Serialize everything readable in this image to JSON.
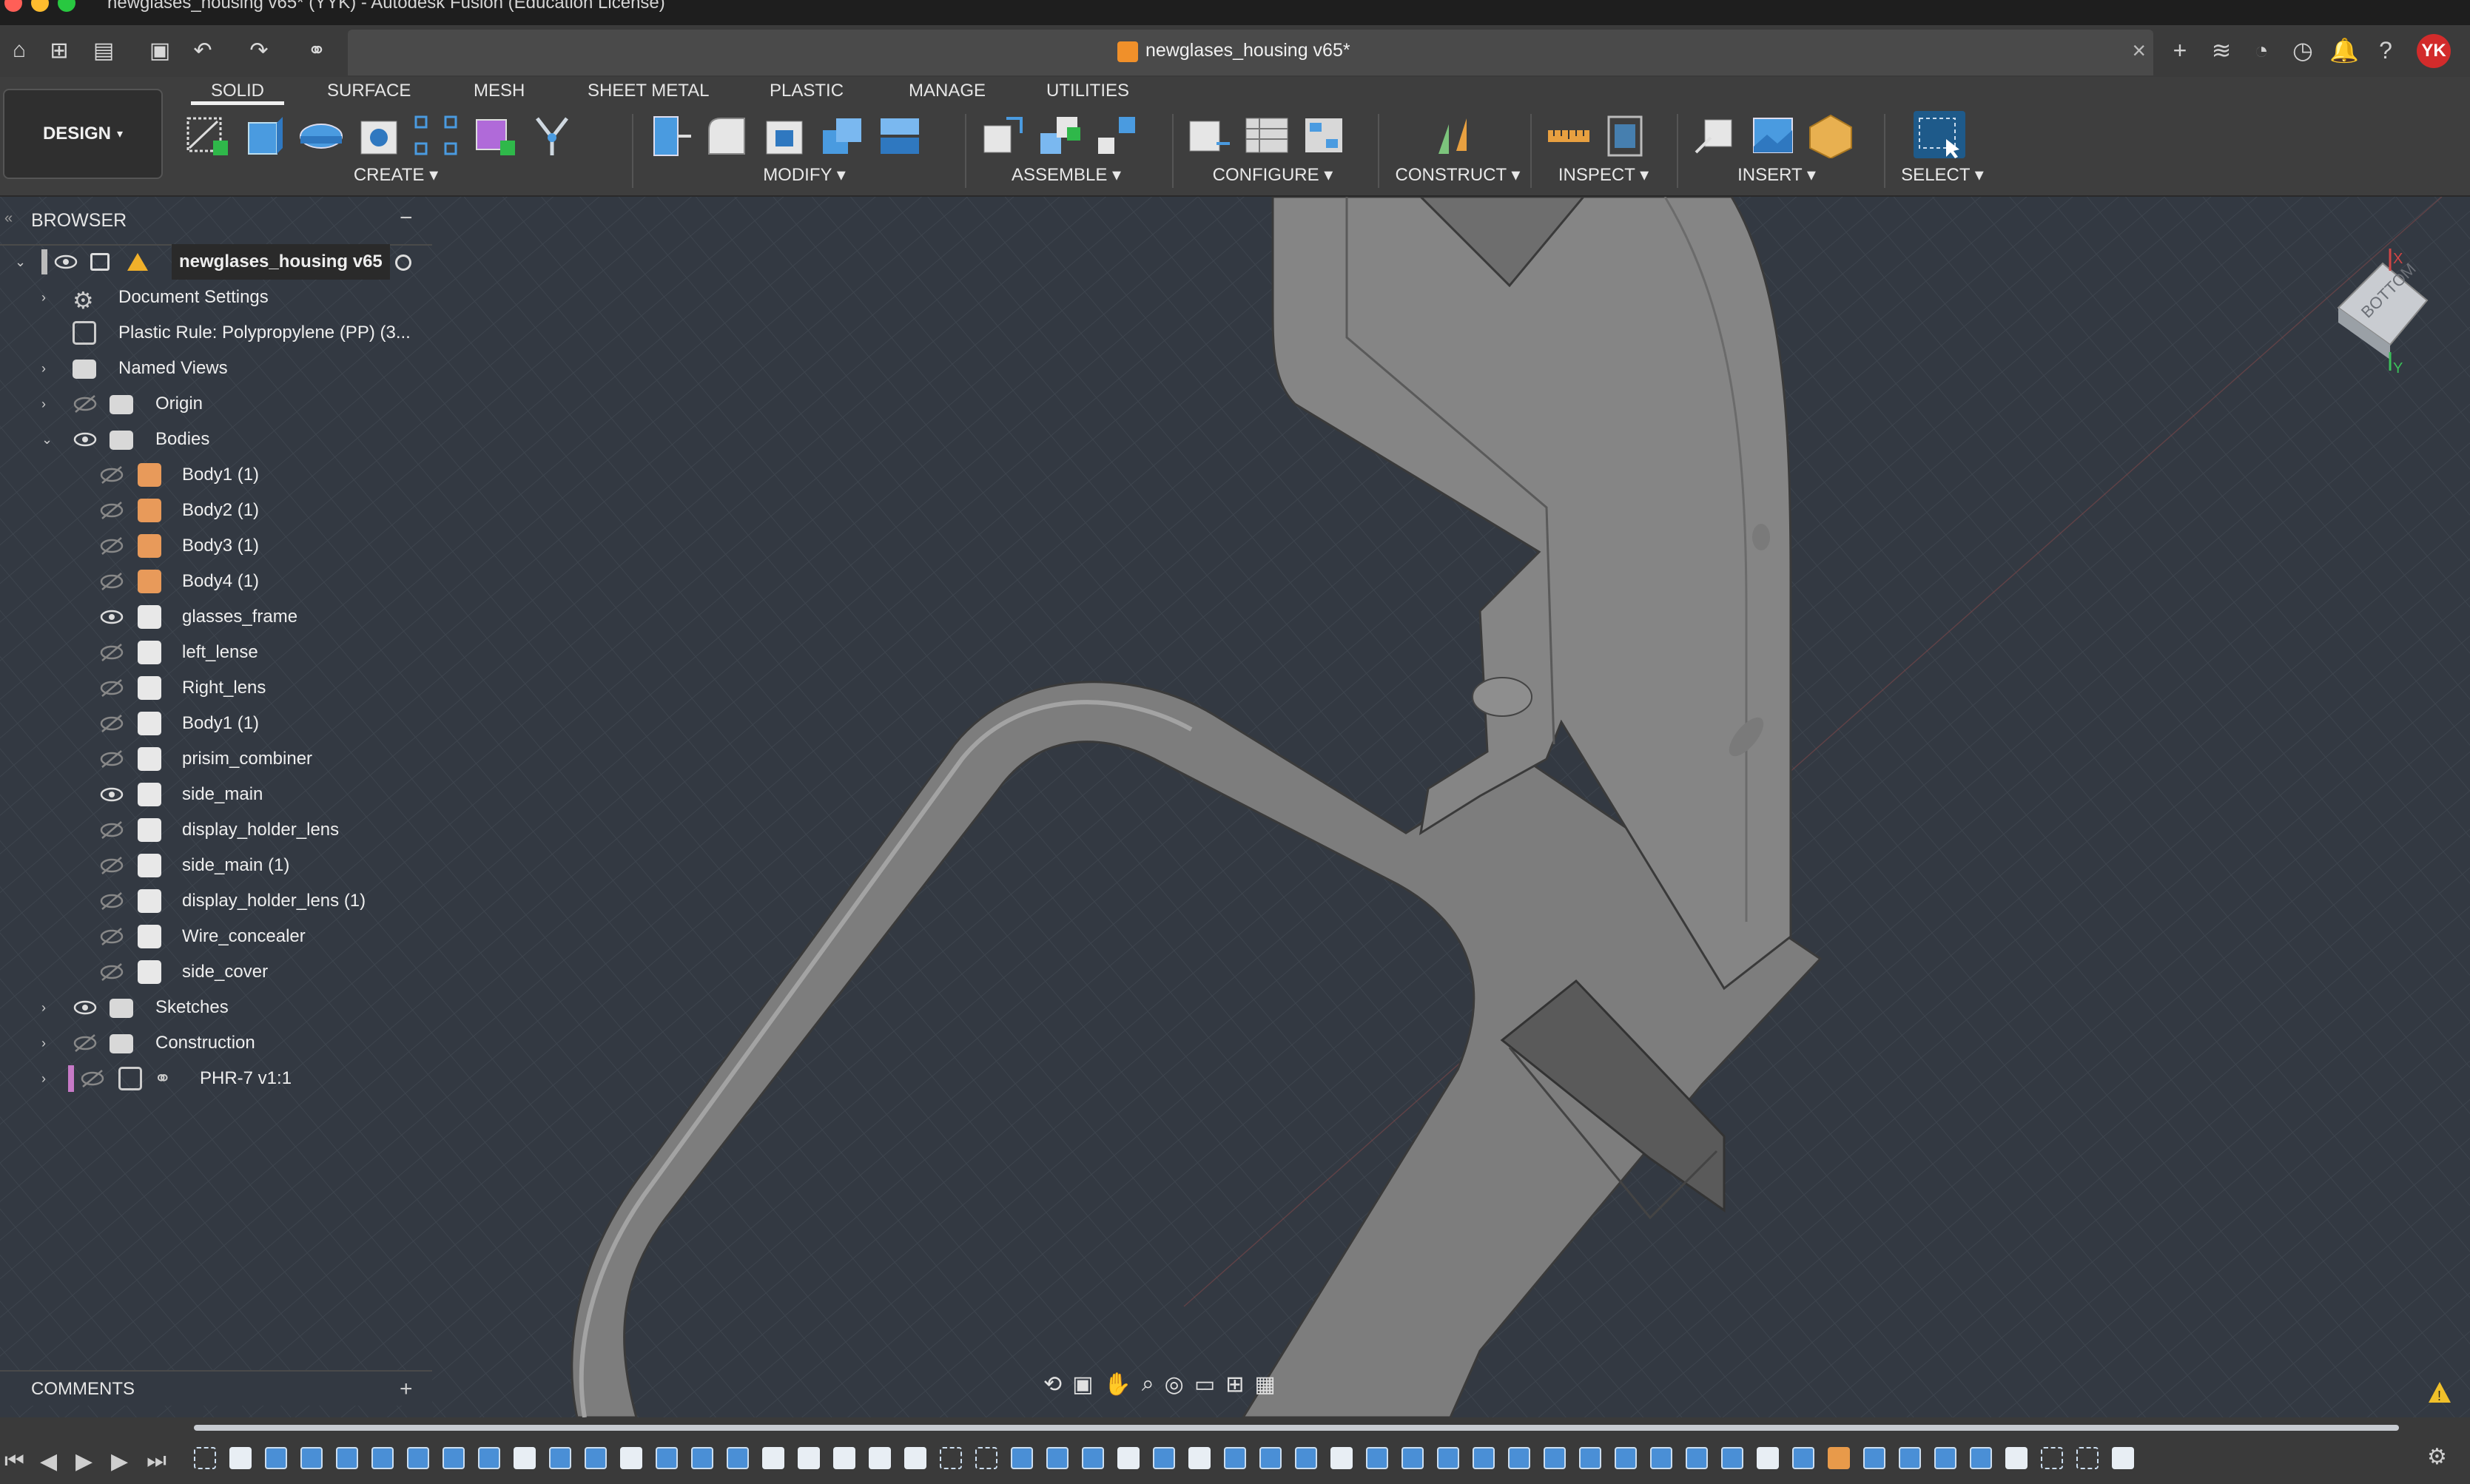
{
  "window": {
    "title": "newglases_housing v65* (YYK) - Autodesk Fusion (Education License)"
  },
  "document_tab": {
    "name": "newglases_housing v65*"
  },
  "user": {
    "initials": "YK"
  },
  "toolbar": {
    "workspace": "DESIGN",
    "tabs": [
      "SOLID",
      "SURFACE",
      "MESH",
      "SHEET METAL",
      "PLASTIC",
      "MANAGE",
      "UTILITIES"
    ],
    "active_tab": "SOLID",
    "groups": [
      "CREATE",
      "MODIFY",
      "ASSEMBLE",
      "CONFIGURE",
      "CONSTRUCT",
      "INSPECT",
      "INSERT",
      "SELECT"
    ]
  },
  "browser": {
    "header": "BROWSER",
    "root": "newglases_housing v65",
    "items": [
      {
        "label": "Document Settings"
      },
      {
        "label": "Plastic Rule: Polypropylene (PP) (3..."
      },
      {
        "label": "Named Views"
      },
      {
        "label": "Origin"
      },
      {
        "label": "Bodies"
      }
    ],
    "bodies": [
      {
        "label": "Body1 (1)",
        "visible": false,
        "color": "#e89a5a"
      },
      {
        "label": "Body2 (1)",
        "visible": false,
        "color": "#e89a5a"
      },
      {
        "label": "Body3 (1)",
        "visible": false,
        "color": "#e89a5a"
      },
      {
        "label": "Body4 (1)",
        "visible": false,
        "color": "#e89a5a"
      },
      {
        "label": "glasses_frame",
        "visible": true,
        "color": "#e8e8e8"
      },
      {
        "label": "left_lense",
        "visible": false,
        "color": "#e8e8e8"
      },
      {
        "label": "Right_lens",
        "visible": false,
        "color": "#e8e8e8"
      },
      {
        "label": "Body1 (1)",
        "visible": false,
        "color": "#e8e8e8"
      },
      {
        "label": "prisim_combiner",
        "visible": false,
        "color": "#e8e8e8"
      },
      {
        "label": "side_main",
        "visible": true,
        "color": "#e8e8e8"
      },
      {
        "label": "display_holder_lens",
        "visible": false,
        "color": "#e8e8e8"
      },
      {
        "label": "side_main (1)",
        "visible": false,
        "color": "#e8e8e8"
      },
      {
        "label": "display_holder_lens (1)",
        "visible": false,
        "color": "#e8e8e8"
      },
      {
        "label": "Wire_concealer",
        "visible": false,
        "color": "#e8e8e8"
      },
      {
        "label": "side_cover",
        "visible": false,
        "color": "#e8e8e8"
      }
    ],
    "bottom_items": [
      {
        "label": "Sketches"
      },
      {
        "label": "Construction"
      },
      {
        "label": "PHR-7 v1:1"
      }
    ]
  },
  "comments": {
    "label": "COMMENTS"
  },
  "viewcube": {
    "face": "BOTTOM",
    "axis_x": "X",
    "axis_y": "Y"
  }
}
